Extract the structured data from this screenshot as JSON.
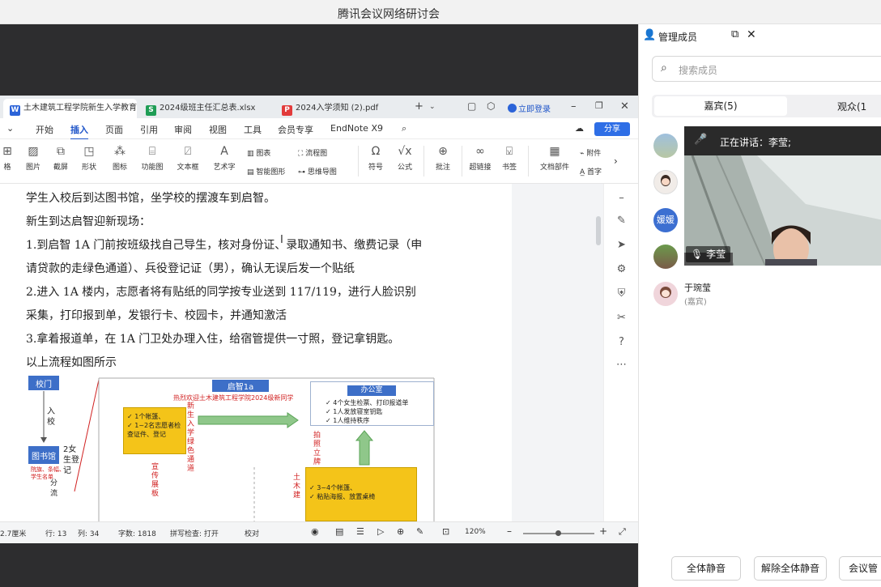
{
  "window": {
    "title": "腾讯会议网络研讨会"
  },
  "wps": {
    "tabs": [
      {
        "icon": "W",
        "color": "#2b63d8",
        "label": "土木建筑工程学院新生入学教育"
      },
      {
        "icon": "S",
        "color": "#1f9d55",
        "label": "2024级班主任汇总表.xlsx"
      },
      {
        "icon": "P",
        "color": "#e23b3b",
        "label": "2024入学须知 (2).pdf"
      }
    ],
    "login_label": "立即登录",
    "menu": [
      "开始",
      "插入",
      "页面",
      "引用",
      "审阅",
      "视图",
      "工具",
      "会员专享",
      "EndNote X9"
    ],
    "selected_menu": "插入",
    "share_label": "分享",
    "toolbar": {
      "left_cut": "格",
      "picture": "图片",
      "screenshot": "截屏",
      "shape": "形状",
      "icon": "图标",
      "function_chart": "功能图",
      "textbox": "文本框",
      "art_text": "艺术字",
      "chart": "图表",
      "smart_shape": "智能图形",
      "flowchart": "流程图",
      "mindmap": "思维导图",
      "symbol": "符号",
      "formula": "公式",
      "comment": "批注",
      "hyperlink": "超链接",
      "bookmark": "书签",
      "doc_parts": "文档部件",
      "attachment": "附件",
      "dropcap": "首字"
    },
    "document": {
      "lines": [
        "学生入校后到达图书馆，坐学校的摆渡车到启智。",
        "新生到达启智迎新现场：",
        "1.到启智 1A 门前按班级找自己导生，核对身份证、录取通知书、缴费记录（申",
        "请贷款的走绿色通道）、兵役登记证（男），确认无误后发一个贴纸",
        "2.进入 1A 楼内，志愿者将有贴纸的同学按专业送到 117/119，进行人脸识别",
        "采集，打印报到单，发银行卡、校园卡，并通知激活",
        "3.拿着报道单，在 1A 门卫处办理入住，给宿管提供一寸照，登记拿钥匙。",
        "以上流程如图所示"
      ],
      "flowchart": {
        "gate": "校门",
        "enter": "入校",
        "library": "图书馆",
        "two_girls": "2女生登记",
        "lib_note": "院旗、条幅、学生名单",
        "qizhi": "启智1a",
        "welcome": "热烈欢迎土木建筑工程学院2024级新同学",
        "desk1_items": [
          "1个帐篷、",
          "1~2名志愿者检查证件、登记"
        ],
        "green_channel": "新生入学绿色通道",
        "publicity": "宣传展板",
        "office_title": "办公室",
        "office_items": [
          "4个女生检票、打印报道单",
          "1人发放寝室钥匙",
          "1人维持秩序"
        ],
        "photo_sign": "拍照立牌",
        "desk2_items": [
          "3~4个帐篷、",
          "粘贴海报、放置桌椅"
        ],
        "civil": "土木建",
        "branch": "分流"
      }
    },
    "status": {
      "position": "2.7厘米",
      "row": "行: 13",
      "col": "列: 34",
      "words": "字数: 1818",
      "spellcheck": "拼写检查: 打开",
      "proofread": "校对",
      "zoom": "120%"
    }
  },
  "panel": {
    "title": "管理成员",
    "search_placeholder": "搜索成员",
    "tab_guests": "嘉宾(5)",
    "tab_audience": "观众(1",
    "speaking_label": "正在讲话：李莹;",
    "video_name": "李莹",
    "avatar_text": "媛媛",
    "member_name": "于琬莹",
    "member_role": "(嘉宾)",
    "buttons": [
      "全体静音",
      "解除全体静音",
      "会议管"
    ]
  }
}
